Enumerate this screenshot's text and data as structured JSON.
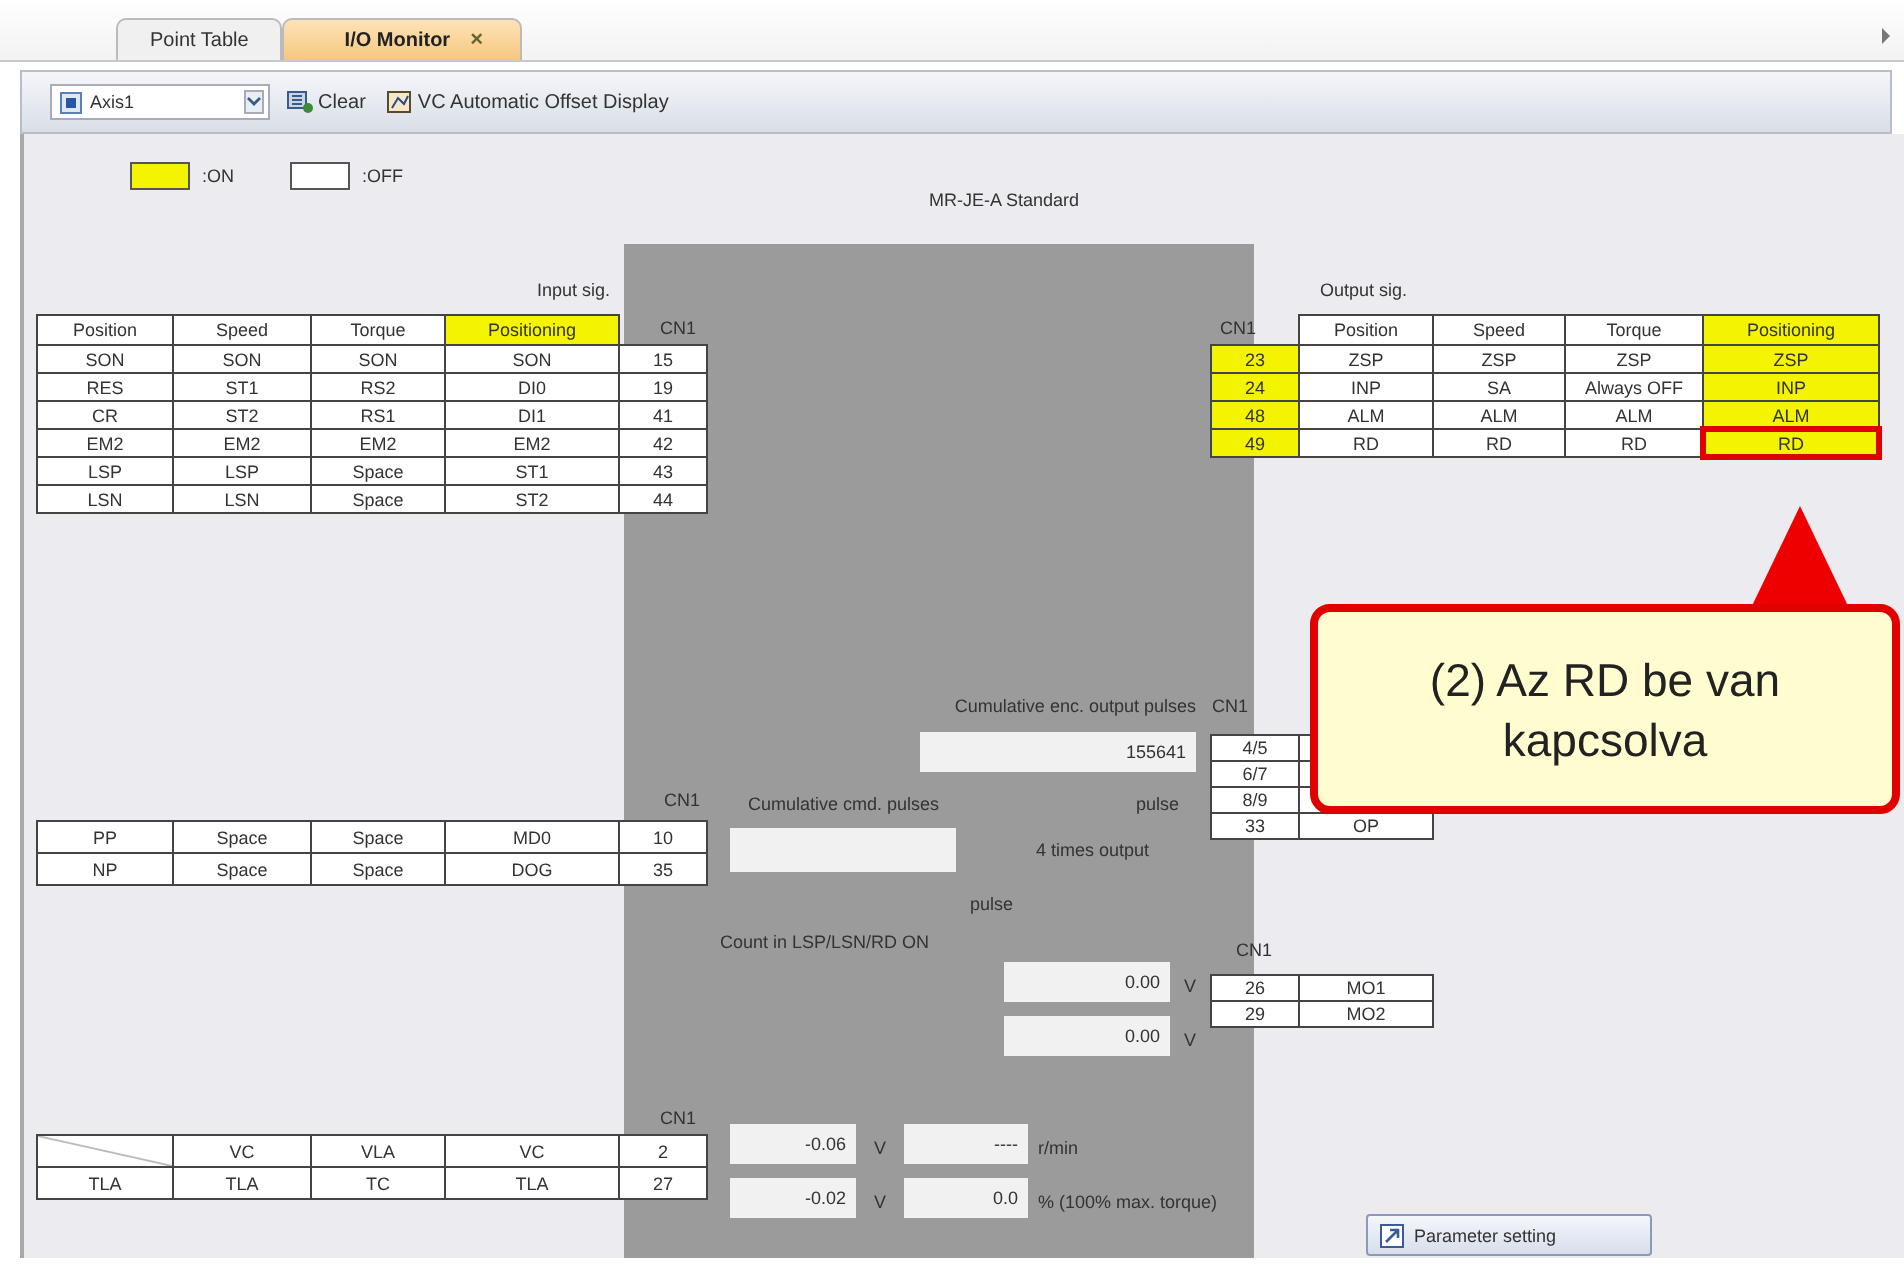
{
  "tabs": [
    {
      "label": "Point Table",
      "selected": false
    },
    {
      "label": "I/O Monitor",
      "close": "×",
      "selected": true
    }
  ],
  "toolbar": {
    "axis": "Axis1",
    "buttons": [
      {
        "label": "Clear",
        "kind": "clear"
      },
      {
        "label": "VC Automatic Offset Display",
        "kind": "offset"
      }
    ]
  },
  "legend": [
    {
      "label": ":ON",
      "on": true
    },
    {
      "label": ":OFF",
      "on": false
    }
  ],
  "model": "MR-JE-A Standard",
  "input": {
    "title": "Input sig.",
    "connector": "CN1",
    "columns": [
      {
        "label": "Position",
        "selected": false
      },
      {
        "label": "Speed",
        "selected": false
      },
      {
        "label": "Torque",
        "selected": false
      },
      {
        "label": "Positioning",
        "selected": true
      }
    ],
    "rows": [
      {
        "cells": [
          "SON",
          "SON",
          "SON",
          "SON"
        ],
        "pin": "15",
        "on": false
      },
      {
        "cells": [
          "RES",
          "ST1",
          "RS2",
          "DI0"
        ],
        "pin": "19",
        "on": false
      },
      {
        "cells": [
          "CR",
          "ST2",
          "RS1",
          "DI1"
        ],
        "pin": "41",
        "on": false
      },
      {
        "cells": [
          "EM2",
          "EM2",
          "EM2",
          "EM2"
        ],
        "pin": "42",
        "on": false
      },
      {
        "cells": [
          "LSP",
          "LSP",
          "Space",
          "ST1"
        ],
        "pin": "43",
        "on": false
      },
      {
        "cells": [
          "LSN",
          "LSN",
          "Space",
          "ST2"
        ],
        "pin": "44",
        "on": false
      }
    ]
  },
  "output": {
    "title": "Output sig.",
    "connector": "CN1",
    "columns": [
      {
        "label": "Position",
        "selected": false
      },
      {
        "label": "Speed",
        "selected": false
      },
      {
        "label": "Torque",
        "selected": false
      },
      {
        "label": "Positioning",
        "selected": true
      }
    ],
    "rows": [
      {
        "pin": "23",
        "cells": [
          "ZSP",
          "ZSP",
          "ZSP",
          "ZSP"
        ],
        "on": true,
        "highlighted": false
      },
      {
        "pin": "24",
        "cells": [
          "INP",
          "SA",
          "Always OFF",
          "INP"
        ],
        "on": true,
        "highlighted": false
      },
      {
        "pin": "48",
        "cells": [
          "ALM",
          "ALM",
          "ALM",
          "ALM"
        ],
        "on": true,
        "highlighted": false
      },
      {
        "pin": "49",
        "cells": [
          "RD",
          "RD",
          "RD",
          "RD"
        ],
        "on": true,
        "highlighted": true
      }
    ]
  },
  "pulses": {
    "enc_label": "Cumulative enc. output pulses",
    "enc_value": "155641",
    "connector": "CN1",
    "enc_pins": [
      {
        "pin": "4/5"
      },
      {
        "pin": "6/7"
      },
      {
        "pin": "8/9"
      },
      {
        "pin": "33",
        "signal": "OP"
      }
    ],
    "cmd_connector": "CN1",
    "cmd_label": "Cumulative cmd. pulses",
    "cmd_unit": "pulse",
    "times_label": "4 times output",
    "unit_below": "pulse",
    "count_label": "Count in LSP/LSN/RD ON",
    "rows": [
      {
        "cells": [
          "PP",
          "Space",
          "Space",
          "MD0"
        ],
        "pin": "10",
        "on": false
      },
      {
        "cells": [
          "NP",
          "Space",
          "Space",
          "DOG"
        ],
        "pin": "35",
        "on": false
      }
    ]
  },
  "analog_out": {
    "connector": "CN1",
    "rows": [
      {
        "value": "0.00",
        "unit": "V",
        "pin": "26",
        "signal": "MO1"
      },
      {
        "value": "0.00",
        "unit": "V",
        "pin": "29",
        "signal": "MO2"
      }
    ]
  },
  "analog_in": {
    "connector": "CN1",
    "rows": [
      {
        "cells": [
          "",
          "VC",
          "VLA",
          "VC"
        ],
        "pin": "2",
        "on": false,
        "value": "-0.06",
        "unit": "V",
        "value2": "----",
        "unit2": "r/min"
      },
      {
        "cells": [
          "TLA",
          "TLA",
          "TC",
          "TLA"
        ],
        "pin": "27",
        "on": false,
        "value": "-0.02",
        "unit": "V",
        "value2": "0.0",
        "unit2": "% (100% max. torque)"
      }
    ]
  },
  "parameter_button": "Parameter setting",
  "callout": {
    "text": "(2) Az RD be van kapcsolva"
  }
}
